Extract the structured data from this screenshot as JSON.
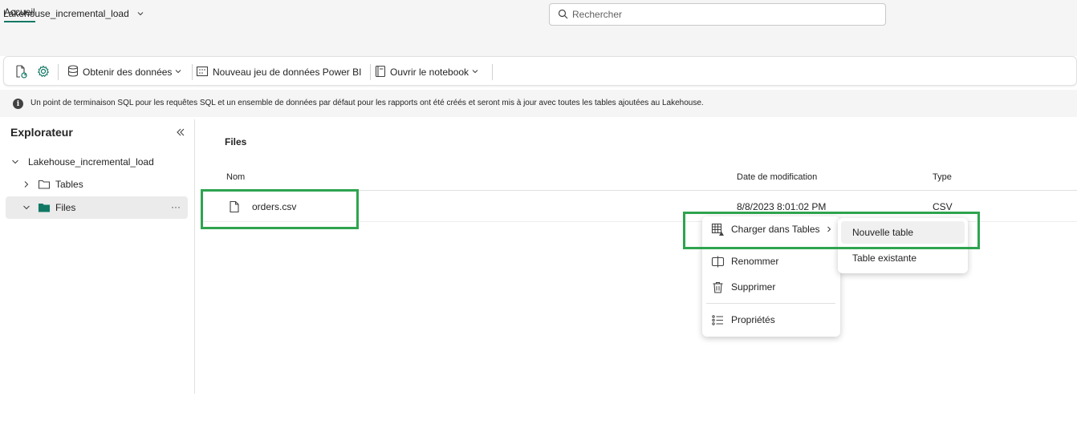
{
  "titlebar": {
    "app_title": "Lakehouse_incremental_load",
    "search_placeholder": "Rechercher"
  },
  "tabs": [
    {
      "label": "Accueil",
      "active": true
    }
  ],
  "toolbar": {
    "get_data_label": "Obtenir des données",
    "new_dataset_label": "Nouveau jeu de données Power BI",
    "open_notebook_label": "Ouvrir le notebook"
  },
  "info_banner": {
    "text": "Un point de terminaison SQL pour les requêtes SQL et un ensemble de données par défaut pour les rapports ont été créés et seront mis à jour avec toutes les tables ajoutées au Lakehouse."
  },
  "explorer": {
    "title": "Explorateur",
    "root_label": "Lakehouse_incremental_load",
    "items": [
      {
        "label": "Tables",
        "expanded": false,
        "selected": false
      },
      {
        "label": "Files",
        "expanded": true,
        "selected": true,
        "more": "···"
      }
    ]
  },
  "files_view": {
    "title": "Files",
    "columns": {
      "name": "Nom",
      "modified": "Date de modification",
      "type": "Type"
    },
    "rows": [
      {
        "name": "orders.csv",
        "modified": "8/8/2023 8:01:02 PM",
        "type": "CSV"
      }
    ]
  },
  "context_menu": {
    "items": [
      {
        "label": "Charger dans Tables",
        "has_submenu": true
      },
      {
        "label": "Renommer"
      },
      {
        "label": "Supprimer"
      },
      {
        "label": "Propriétés"
      }
    ],
    "submenu": [
      {
        "label": "Nouvelle table",
        "hovered": true
      },
      {
        "label": "Table existante"
      }
    ]
  },
  "colors": {
    "accent": "#117865",
    "highlight": "#2ea44f",
    "folder_selected": "#117865"
  }
}
